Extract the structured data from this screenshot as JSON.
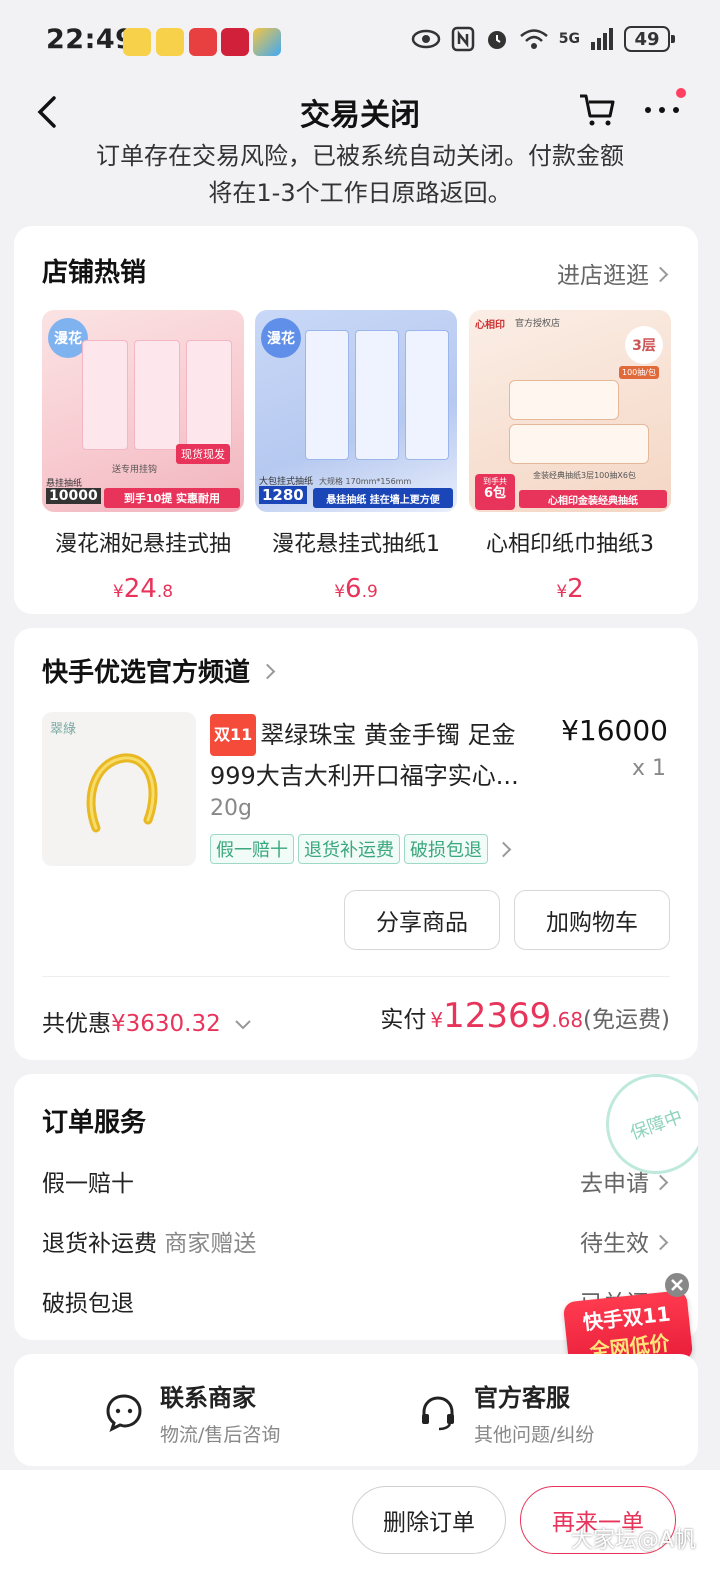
{
  "status_bar": {
    "time": "22:49",
    "battery": "49",
    "network": "5G"
  },
  "header": {
    "title": "交易关闭"
  },
  "notice": {
    "line1": "订单存在交易风险，已被系统自动关闭。付款金额",
    "line2": "将在1-3个工作日原路返回。"
  },
  "store_hot": {
    "title": "店铺热销",
    "link": "进店逛逛",
    "products": [
      {
        "name": "漫花湘妃悬挂式抽",
        "price_int": "24",
        "price_dec": ".8",
        "currency": "¥",
        "img_brand": "漫花",
        "img_tag1": "悬挂抽纸",
        "img_tag2": "10000",
        "img_cta": "到手10提  实惠耐用",
        "img_flag": "现货现发",
        "img_note": "送专用挂钩"
      },
      {
        "name": "漫花悬挂式抽纸1",
        "price_int": "6",
        "price_dec": ".9",
        "currency": "¥",
        "img_brand": "漫花",
        "img_tag1": "大包挂式抽纸",
        "img_tag2": "1280",
        "img_cta": "悬挂抽纸  挂在墙上更方便",
        "img_note": "大规格 170mm*156mm"
      },
      {
        "name": "心相印纸巾抽纸3",
        "price_int": "2",
        "price_dec": "",
        "currency": "¥",
        "img_brand": "心相印",
        "img_tag1": "官方授权店",
        "img_tag2": "3层",
        "img_tag3": "100抽/包",
        "img_cta": "心相印金装经典抽纸",
        "img_note": "金装经典抽纸3层100抽X6包",
        "img_flag": "到手共",
        "img_count": "6包"
      }
    ]
  },
  "channel": {
    "title": "快手优选官方频道",
    "item": {
      "thumb_brand": "翠綠",
      "badge": "双11",
      "title_line1": "翠绿珠宝 黄金手镯 足金",
      "title_line2": "999大吉大利开口福字实心...",
      "price": "¥16000",
      "qty": "x 1",
      "spec": "20g",
      "tags": [
        "假一赔十",
        "退货补运费",
        "破损包退"
      ]
    },
    "buttons": {
      "share": "分享商品",
      "add_cart": "加购物车"
    },
    "discount_label": "共优惠",
    "discount_value": "¥3630.32",
    "paid_label": "实付",
    "paid_currency": "¥",
    "paid_int": "12369",
    "paid_dec": ".68",
    "shipping": "(免运费)"
  },
  "service": {
    "title": "订单服务",
    "stamp": "保障中",
    "rows": [
      {
        "label": "假一赔十",
        "sub": "",
        "value": "去申请"
      },
      {
        "label": "退货补运费",
        "sub": "商家赠送",
        "value": "待生效"
      },
      {
        "label": "破损包退",
        "sub": "",
        "value": "已关闭"
      }
    ],
    "promo_line1": "快手双11",
    "promo_line2": "全网低价"
  },
  "contact": {
    "merchant_title": "联系商家",
    "merchant_sub": "物流/售后咨询",
    "support_title": "官方客服",
    "support_sub": "其他问题/纠纷"
  },
  "bottom": {
    "delete": "删除订单",
    "again": "再来一单"
  },
  "watermark": "大家坛@A帆",
  "colors": {
    "accent": "#e8345a",
    "tag_green": "#3aa77e",
    "bg": "#f2f2f4"
  }
}
